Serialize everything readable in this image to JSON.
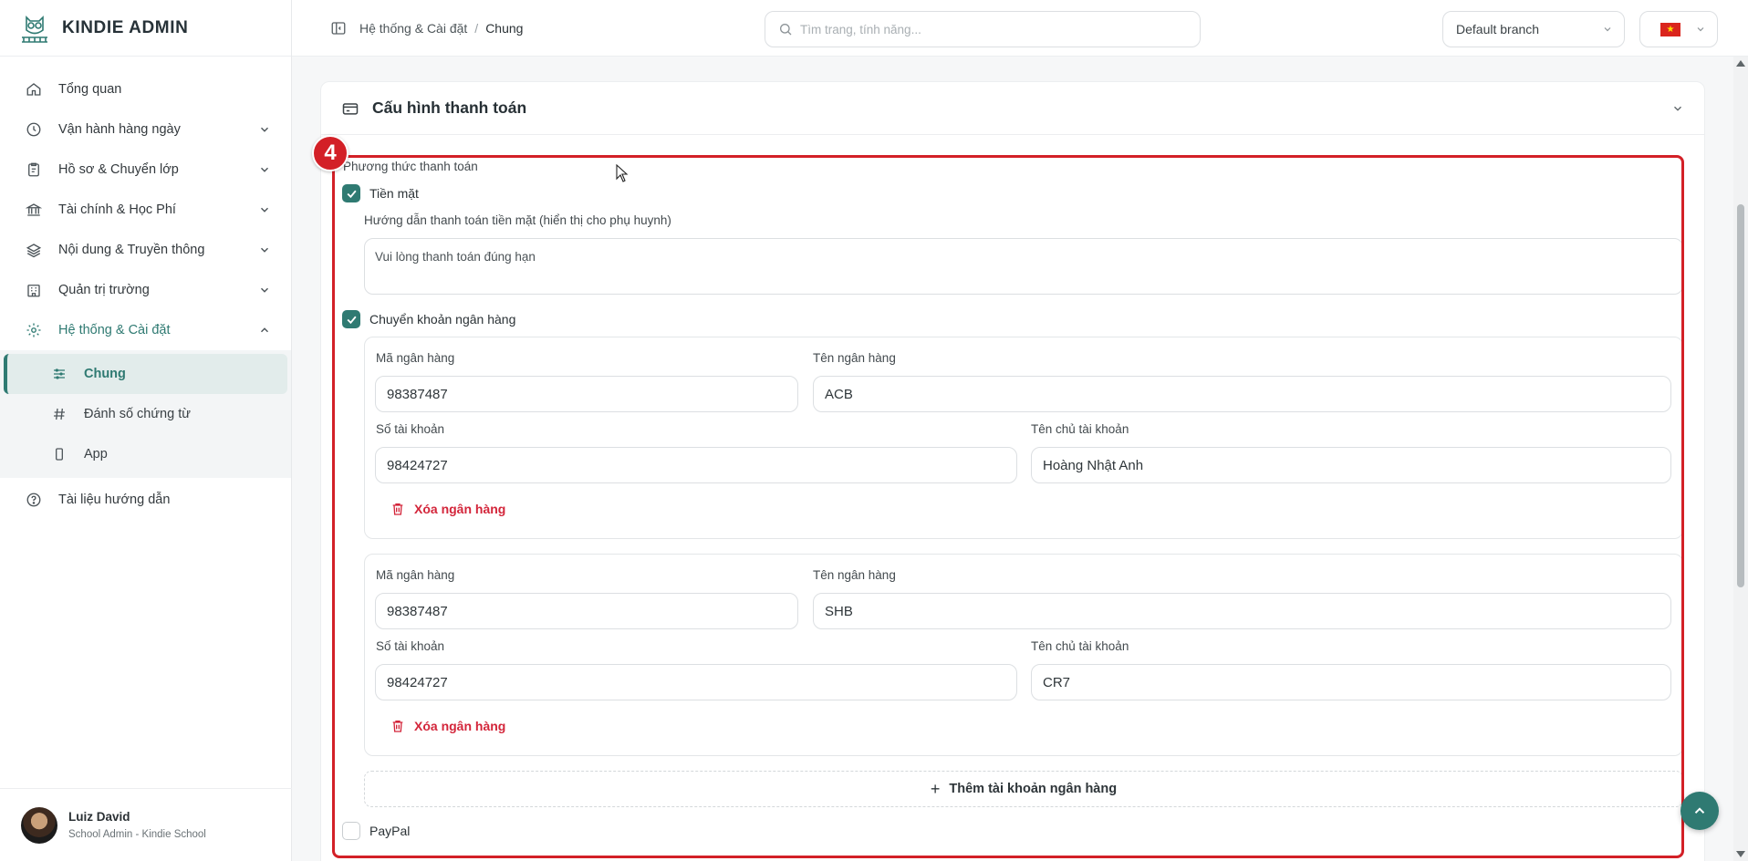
{
  "brand": {
    "title": "KINDIE ADMIN"
  },
  "sidebar": {
    "items": [
      {
        "label": "Tổng quan",
        "icon": "home-icon",
        "has_chevron": false
      },
      {
        "label": "Vận hành hàng ngày",
        "icon": "clock-icon",
        "has_chevron": true
      },
      {
        "label": "Hồ sơ & Chuyển lớp",
        "icon": "clipboard-icon",
        "has_chevron": true
      },
      {
        "label": "Tài chính & Học Phí",
        "icon": "bank-icon",
        "has_chevron": true
      },
      {
        "label": "Nội dung & Truyền thông",
        "icon": "layers-icon",
        "has_chevron": true
      },
      {
        "label": "Quản trị trường",
        "icon": "building-icon",
        "has_chevron": true
      },
      {
        "label": "Hệ thống & Cài đặt",
        "icon": "gear-icon",
        "has_chevron": true,
        "expanded": true
      },
      {
        "label": "Tài liệu hướng dẫn",
        "icon": "help-circle-icon",
        "has_chevron": false
      }
    ],
    "subitems": [
      {
        "label": "Chung",
        "icon": "sliders-icon",
        "active": true
      },
      {
        "label": "Đánh số chứng từ",
        "icon": "hash-icon",
        "active": false
      },
      {
        "label": "App",
        "icon": "phone-icon",
        "active": false
      }
    ]
  },
  "user": {
    "name": "Luiz David",
    "role": "School Admin - Kindie School"
  },
  "header": {
    "breadcrumb": [
      "Hệ thống & Cài đặt",
      "Chung"
    ],
    "search_placeholder": "Tìm trang, tính năng...",
    "branch": "Default branch",
    "language_flag": "vietnam-flag-icon"
  },
  "payment": {
    "section_title": "Cấu hình thanh toán",
    "highlight_number": "4",
    "methods_label": "Phương thức thanh toán",
    "cash": {
      "label": "Tiền mặt",
      "checked": true,
      "instruction_label": "Hướng dẫn thanh toán tiền mặt (hiển thị cho phụ huynh)",
      "instruction_value": "Vui lòng thanh toán đúng hạn"
    },
    "bank_transfer": {
      "label": "Chuyển khoản ngân hàng",
      "checked": true,
      "banks": [
        {
          "bank_code_label": "Mã ngân hàng",
          "bank_code": "98387487",
          "bank_name_label": "Tên ngân hàng",
          "bank_name": "ACB",
          "account_number_label": "Số tài khoản",
          "account_number": "98424727",
          "account_holder_label": "Tên chủ tài khoản",
          "account_holder": "Hoàng Nhật Anh",
          "delete_label": "Xóa ngân hàng"
        },
        {
          "bank_code_label": "Mã ngân hàng",
          "bank_code": "98387487",
          "bank_name_label": "Tên ngân hàng",
          "bank_name": "SHB",
          "account_number_label": "Số tài khoản",
          "account_number": "98424727",
          "account_holder_label": "Tên chủ tài khoản",
          "account_holder": "CR7",
          "delete_label": "Xóa ngân hàng"
        }
      ],
      "add_label": "Thêm tài khoản ngân hàng"
    },
    "paypal": {
      "label": "PayPal",
      "checked": false
    }
  },
  "colors": {
    "accent": "#2f7a72",
    "highlight": "#d32027",
    "danger": "#d3253a"
  }
}
